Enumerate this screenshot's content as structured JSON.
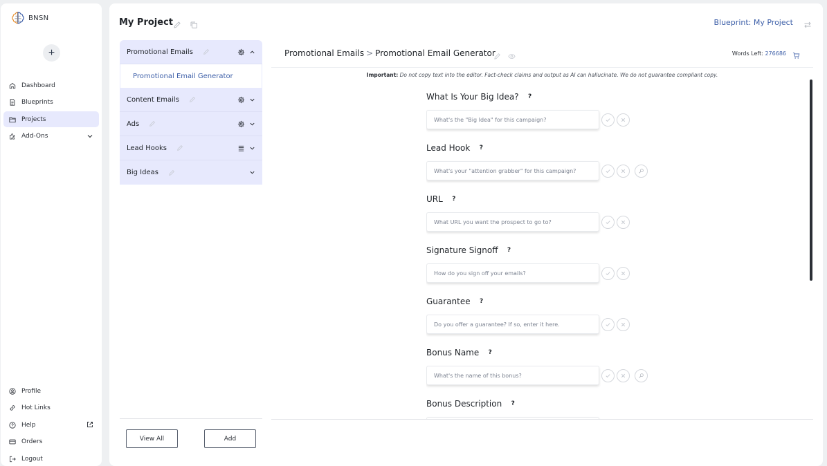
{
  "brand": {
    "name": "BNSN"
  },
  "sidebar": {
    "nav": [
      {
        "label": "Dashboard",
        "icon": "home-icon",
        "active": false
      },
      {
        "label": "Blueprints",
        "icon": "document-icon",
        "active": false
      },
      {
        "label": "Projects",
        "icon": "folder-icon",
        "active": true
      },
      {
        "label": "Add-Ons",
        "icon": "puzzle-icon",
        "active": false
      }
    ],
    "bottom_nav": [
      {
        "label": "Profile",
        "icon": "user-circle-icon"
      },
      {
        "label": "Hot Links",
        "icon": "link-icon"
      },
      {
        "label": "Help",
        "icon": "help-circle-icon"
      },
      {
        "label": "Orders",
        "icon": "card-icon"
      },
      {
        "label": "Logout",
        "icon": "logout-icon"
      }
    ]
  },
  "header": {
    "project_title": "My Project",
    "blueprint_label": "Blueprint: My Project"
  },
  "project_list": {
    "groups": [
      {
        "label": "Promotional Emails",
        "has_gear": true,
        "expanded": true,
        "children": [
          "Promotional Email Generator"
        ]
      },
      {
        "label": "Content Emails",
        "has_gear": true,
        "expanded": false
      },
      {
        "label": "Ads",
        "has_gear": true,
        "expanded": false
      },
      {
        "label": "Lead Hooks",
        "has_list": true,
        "expanded": false
      },
      {
        "label": "Big Ideas",
        "expanded": false
      }
    ],
    "view_all_label": "View All",
    "add_label": "Add"
  },
  "editor": {
    "breadcrumb_parent": "Promotional Emails",
    "breadcrumb_sep": ">",
    "breadcrumb_current": "Promotional Email Generator",
    "words_left_label": "Words Left:",
    "words_left_value": "276686",
    "notice_bold": "Important:",
    "notice_text": "Do not copy text into the editor. Fact-check claims and output as AI can hallucinate. We do not guarantee compliant copy.",
    "fields": [
      {
        "label": "What Is Your Big Idea?",
        "placeholder": "What's the \"Big Idea\" for this campaign?",
        "magic": false
      },
      {
        "label": "Lead Hook",
        "placeholder": "What's your \"attention grabber\" for this campaign?",
        "magic": true
      },
      {
        "label": "URL",
        "placeholder": "What URL you want the prospect to go to?",
        "magic": false
      },
      {
        "label": "Signature Signoff",
        "placeholder": "How do you sign off your emails?",
        "magic": false
      },
      {
        "label": "Guarantee",
        "placeholder": "Do you offer a guarantee? If so, enter it here.",
        "magic": false
      },
      {
        "label": "Bonus Name",
        "placeholder": "What's the name of this bonus?",
        "magic": true
      },
      {
        "label": "Bonus Description",
        "placeholder": "",
        "magic": false
      }
    ]
  }
}
